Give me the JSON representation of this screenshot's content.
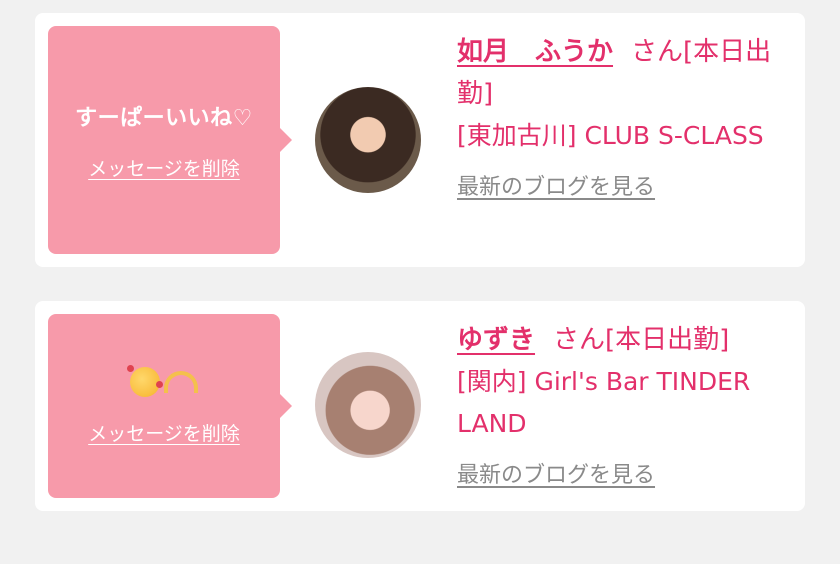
{
  "messages": [
    {
      "bubble_text": "すーぱーいいね♡",
      "delete_label": "メッセージを削除",
      "name": "如月　ふうか",
      "suffix": "さん[本日出勤]",
      "shop": "[東加古川] CLUB S-CLASS",
      "blog_link": "最新のブログを見る"
    },
    {
      "bubble_emoji": [
        "smiling-face-with-hearts-icon",
        "heart-hands-icon"
      ],
      "delete_label": "メッセージを削除",
      "name": "ゆずき",
      "suffix": "さん[本日出勤]",
      "shop": "[関内] Girl's Bar TINDER LAND",
      "blog_link": "最新のブログを見る"
    }
  ],
  "colors": {
    "bubble": "#f79aaa",
    "accent": "#e3306b",
    "muted_link": "#8a8a8a",
    "background": "#f1f1f1"
  }
}
